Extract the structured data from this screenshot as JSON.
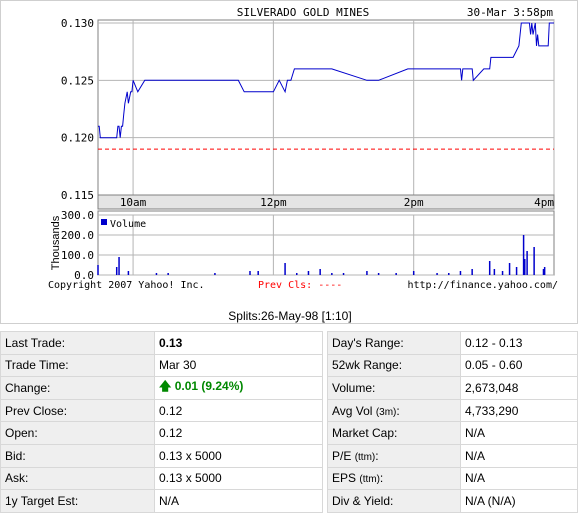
{
  "chart_data": {
    "type": "line",
    "title": "SILVERADO GOLD MINES",
    "datetime": "30-Mar 3:58pm",
    "price_axis": {
      "ylim": [
        0.115,
        0.13
      ],
      "ticks": [
        "0.130",
        "0.125",
        "0.120",
        "0.115"
      ]
    },
    "time_axis": {
      "ticks": [
        "10am",
        "12pm",
        "2pm",
        "4pm"
      ]
    },
    "prev_close_value": 0.119,
    "price_series": {
      "name": "",
      "x_minutes": [
        0,
        1,
        2,
        3,
        4,
        16,
        17,
        18,
        19,
        20,
        21,
        22,
        23,
        25,
        26,
        28,
        29,
        30,
        34,
        40,
        50,
        60,
        80,
        100,
        120,
        125,
        135,
        150,
        155,
        160,
        162,
        165,
        168,
        170,
        180,
        200,
        230,
        240,
        265,
        270,
        300,
        310,
        311,
        312,
        320,
        321,
        330,
        335,
        336,
        337,
        345,
        355,
        360,
        362,
        365,
        369,
        370,
        371,
        372,
        374,
        375,
        376,
        377,
        380,
        384,
        385,
        386,
        387,
        389,
        390
      ],
      "y": [
        0.121,
        0.121,
        0.12,
        0.12,
        0.12,
        0.12,
        0.121,
        0.121,
        0.12,
        0.121,
        0.121,
        0.122,
        0.123,
        0.124,
        0.123,
        0.124,
        0.124,
        0.125,
        0.124,
        0.125,
        0.125,
        0.125,
        0.125,
        0.125,
        0.125,
        0.124,
        0.124,
        0.124,
        0.125,
        0.124,
        0.125,
        0.125,
        0.126,
        0.126,
        0.126,
        0.126,
        0.125,
        0.125,
        0.126,
        0.126,
        0.126,
        0.126,
        0.125,
        0.126,
        0.126,
        0.125,
        0.126,
        0.126,
        0.127,
        0.127,
        0.127,
        0.127,
        0.128,
        0.13,
        0.13,
        0.13,
        0.129,
        0.13,
        0.129,
        0.13,
        0.128,
        0.129,
        0.128,
        0.128,
        0.128,
        0.128,
        0.13,
        0.13,
        0.13,
        0.13
      ]
    },
    "volume_axis": {
      "ylim": [
        0,
        300
      ],
      "ticks": [
        "300.0",
        "200.0",
        "100.0",
        "0.0"
      ],
      "label": "Thousands"
    },
    "volume_series": {
      "name": "Volume",
      "x_minutes": [
        0,
        16,
        18,
        26,
        50,
        60,
        100,
        130,
        137,
        160,
        170,
        180,
        190,
        200,
        210,
        230,
        240,
        255,
        270,
        290,
        300,
        310,
        320,
        335,
        339,
        346,
        352,
        358,
        364,
        365,
        367,
        373,
        381,
        382
      ],
      "values": [
        50,
        40,
        90,
        20,
        10,
        10,
        10,
        20,
        20,
        60,
        10,
        20,
        30,
        10,
        10,
        20,
        10,
        10,
        20,
        10,
        10,
        20,
        30,
        70,
        30,
        20,
        60,
        40,
        200,
        80,
        120,
        140,
        30,
        40
      ]
    },
    "footer_left": "Copyright 2007 Yahoo! Inc.",
    "footer_center": "Prev Cls: ----",
    "footer_right": "http://finance.yahoo.com/",
    "colors": {
      "line": "#0000cc",
      "prev_close": "#ff0000",
      "grid": "#b4b4b4",
      "bar": "#0000cc"
    }
  },
  "splits": "Splits:26-May-98 [1:10]",
  "left_table": [
    {
      "label": "Last Trade:",
      "value": "0.13"
    },
    {
      "label": "Trade Time:",
      "value": "Mar 30"
    },
    {
      "label": "Change:",
      "value": "0.01 (9.24%)",
      "direction": "up"
    },
    {
      "label": "Prev Close:",
      "value": "0.12"
    },
    {
      "label": "Open:",
      "value": "0.12"
    },
    {
      "label": "Bid:",
      "value": "0.13 x 5000"
    },
    {
      "label": "Ask:",
      "value": "0.13 x 5000"
    },
    {
      "label": "1y Target Est:",
      "value": "N/A"
    }
  ],
  "right_table": [
    {
      "label": "Day's Range:",
      "value": "0.12 - 0.13"
    },
    {
      "label": "52wk Range:",
      "value": "0.05 - 0.60"
    },
    {
      "label": "Volume:",
      "value": "2,673,048"
    },
    {
      "label": "Avg Vol",
      "label_suffix": "(3m)",
      "value": "4,733,290"
    },
    {
      "label": "Market Cap:",
      "value": "N/A"
    },
    {
      "label": "P/E",
      "label_suffix": "(ttm)",
      "value": "N/A"
    },
    {
      "label": "EPS",
      "label_suffix": "(ttm)",
      "value": "N/A"
    },
    {
      "label": "Div & Yield:",
      "value": "N/A (N/A)"
    }
  ]
}
